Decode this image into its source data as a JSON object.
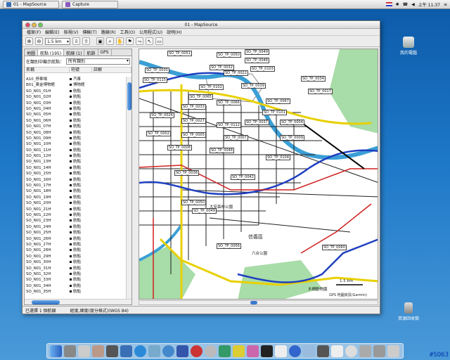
{
  "topbar": {
    "tasks": [
      "01 - MapSource",
      "Capture"
    ],
    "clock": "上午 11:37"
  },
  "window": {
    "title": "01 - MapSource",
    "menu": [
      "檔案(F)",
      "編輯(E)",
      "檢視(V)",
      "傳輸(T)",
      "路線(R)",
      "工具(O)",
      "公用程式(U)",
      "說明(H)"
    ],
    "zoom": "1.5 km"
  },
  "panel": {
    "tabs": [
      "地圖",
      "航點 (195)",
      "航線 (1)",
      "航跡",
      "GPS"
    ],
    "filter_label": "在類別中顯示航點：",
    "filter_value": "所有類別",
    "columns": [
      "名稱",
      "符號",
      "註解"
    ],
    "rows": [
      {
        "name": "A10_停車場",
        "symbol": "汽車"
      },
      {
        "name": "B01_黃金博物館",
        "symbol": "博物館"
      },
      {
        "name": "SO_N01_01H",
        "symbol": "航點"
      },
      {
        "name": "SO_N01_02H",
        "symbol": "航點"
      },
      {
        "name": "SO_N01_03H",
        "symbol": "航點"
      },
      {
        "name": "SO_N01_04H",
        "symbol": "航點"
      },
      {
        "name": "SO_N01_05H",
        "symbol": "航點"
      },
      {
        "name": "SO_N01_06H",
        "symbol": "航點"
      },
      {
        "name": "SO_N01_07H",
        "symbol": "航點"
      },
      {
        "name": "SO_N01_08H",
        "symbol": "航點"
      },
      {
        "name": "SO_N01_09H",
        "symbol": "航點"
      },
      {
        "name": "SO_N01_10H",
        "symbol": "航點"
      },
      {
        "name": "SO_N01_11H",
        "symbol": "航點"
      },
      {
        "name": "SO_N01_12H",
        "symbol": "航點"
      },
      {
        "name": "SO_N01_13H",
        "symbol": "航點"
      },
      {
        "name": "SO_N01_14H",
        "symbol": "航點"
      },
      {
        "name": "SO_N01_15H",
        "symbol": "航點"
      },
      {
        "name": "SO_N01_16H",
        "symbol": "航點"
      },
      {
        "name": "SO_N01_17H",
        "symbol": "航點"
      },
      {
        "name": "SO_N01_18H",
        "symbol": "航點"
      },
      {
        "name": "SO_N01_19H",
        "symbol": "航點"
      },
      {
        "name": "SO_N01_20H",
        "symbol": "航點"
      },
      {
        "name": "SO_N01_21H",
        "symbol": "航點"
      },
      {
        "name": "SO_N01_22H",
        "symbol": "航點"
      },
      {
        "name": "SO_N01_23H",
        "symbol": "航點"
      },
      {
        "name": "SO_N01_24H",
        "symbol": "航點"
      },
      {
        "name": "SO_N01_25H",
        "symbol": "航點"
      },
      {
        "name": "SO_N01_26H",
        "symbol": "航點"
      },
      {
        "name": "SO_N01_27H",
        "symbol": "航點"
      },
      {
        "name": "SO_N01_28H",
        "symbol": "航點"
      },
      {
        "name": "SO_N01_29H",
        "symbol": "航點"
      },
      {
        "name": "SO_N01_30H",
        "symbol": "航點"
      },
      {
        "name": "SO_N01_31H",
        "symbol": "航點"
      },
      {
        "name": "SO_N01_32H",
        "symbol": "航點"
      },
      {
        "name": "SO_N01_33H",
        "symbol": "航點"
      },
      {
        "name": "SO_N01_34H",
        "symbol": "航點"
      },
      {
        "name": "SO_N01_35H",
        "symbol": "航點"
      }
    ]
  },
  "map": {
    "labels": [
      "SO_TP_0051",
      "SO_TP_0050",
      "SO_TP_0049",
      "SO_TP_0048",
      "SO_TP_0032",
      "SO_TP_0035",
      "SO_TP_0022",
      "SO_TP_0103",
      "SO_TP_0115",
      "SO_TP_0102",
      "SO_TP_0039",
      "SO_TP_0034",
      "SO_TP_0017",
      "SO_TP_0065",
      "SO_TP_0066",
      "SO_TP_0033",
      "SO_TP_0067",
      "SO_TP_0101",
      "SO_TP_0026",
      "SO_TP_0027",
      "SO_TP_0037",
      "SO_TP_0112",
      "SO_TP_0004",
      "SO_TP_0002",
      "SO_TP_0005",
      "SO_TP_0007",
      "SO_TP_0009",
      "SO_TP_0008",
      "SO_TP_0048",
      "SO_TP_0104",
      "SO_TP_0038",
      "SO_TP_0042",
      "SO_TP_0050",
      "SO_TP_0049",
      "SO_TP_0056",
      "SO_TP_0060"
    ],
    "places": [
      "信義區",
      "六合公園",
      "木柵動物園",
      "大安森林公園"
    ],
    "scale": "1.5 km",
    "footer": "GPS 地圖資訊(Garmin)"
  },
  "status": {
    "left": "已選擇 1 個航線",
    "right": "經度,緯度(度分格式)(WGS 84)"
  },
  "desktop": {
    "icons": [
      "我的電腦",
      "資源回收筒"
    ]
  },
  "watermark": "#SO63"
}
